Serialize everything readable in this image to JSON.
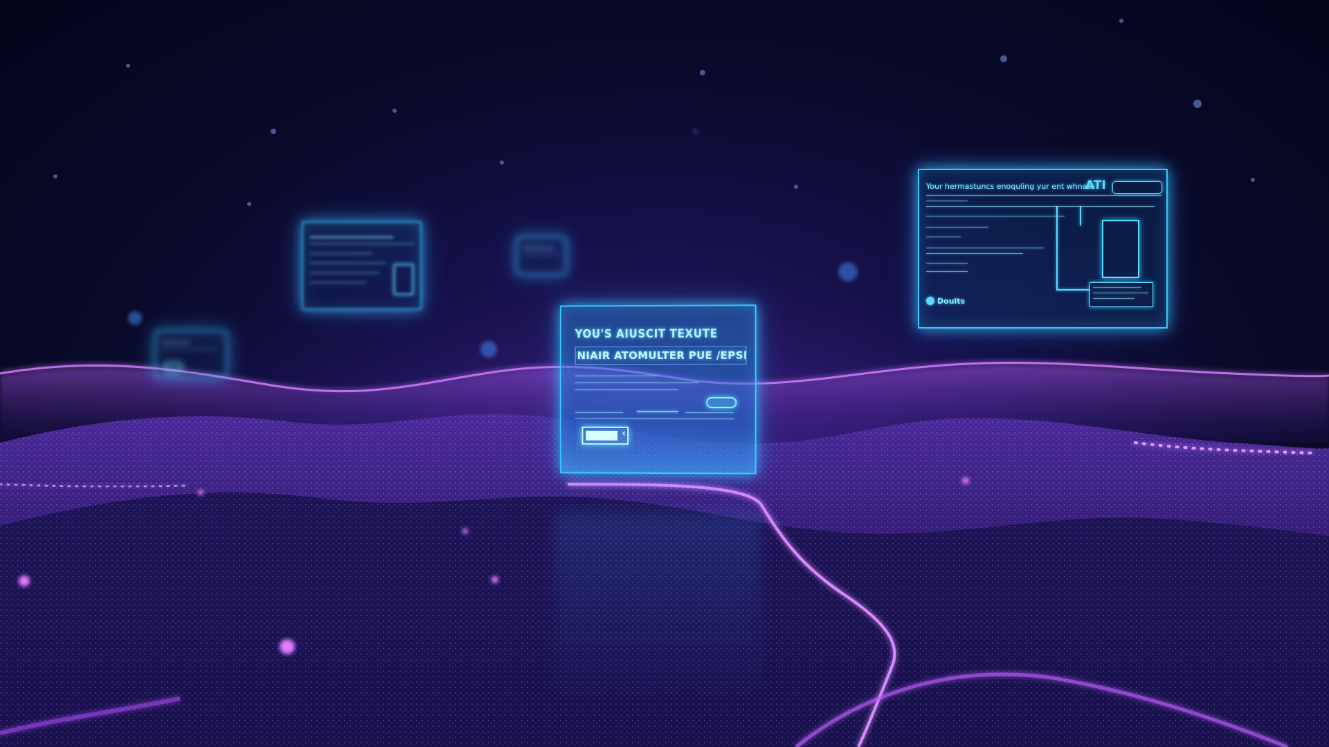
{
  "center_panel": {
    "title": "YOU'S AIUSCIT TEXUTE",
    "subtitle": "NIAIR ATOMULTER PUE /EPSBES"
  },
  "right_panel": {
    "header": "Your hermastuncs enoquling yur ent whnass",
    "badge": "ATI",
    "footer_label": "Douits"
  },
  "colors": {
    "panel_glow": "#37c8ff",
    "wave_magenta": "#c45cff",
    "background": "#05061a"
  }
}
